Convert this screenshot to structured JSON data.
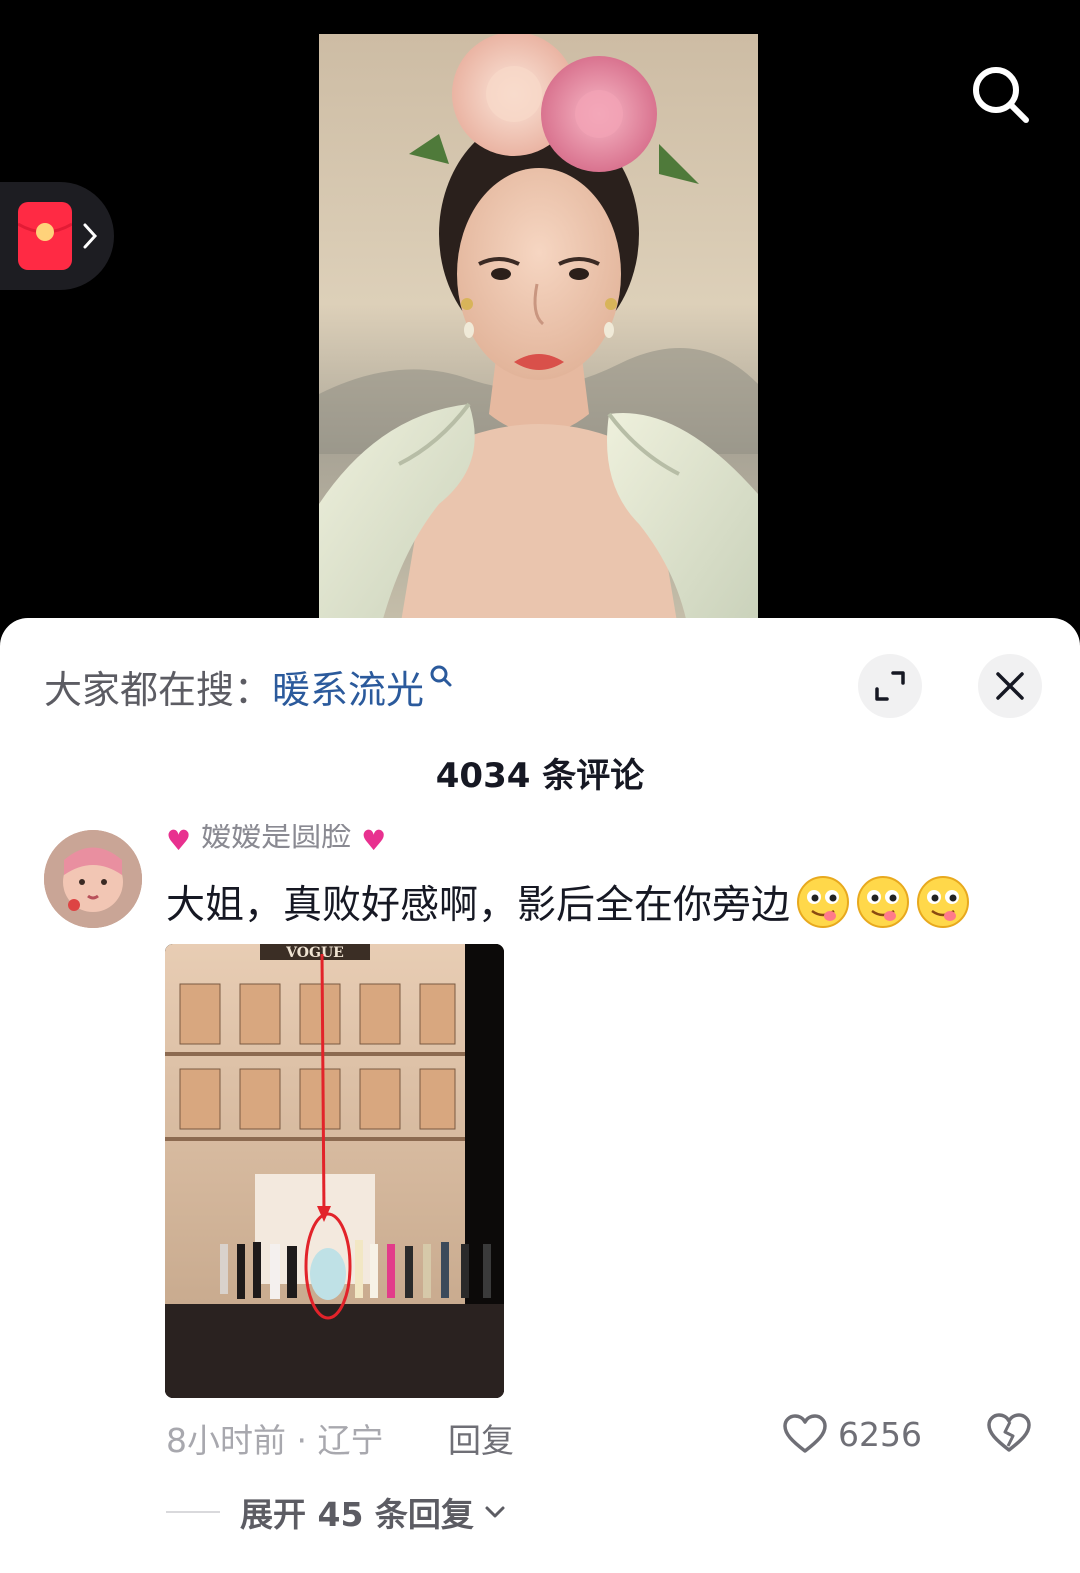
{
  "top": {
    "search_icon": "search-icon",
    "red_packet_icon": "red-packet-icon"
  },
  "sheet": {
    "hot_search_prefix": "大家都在搜：",
    "hot_search_keyword": "暖系流光",
    "comment_count_title": "4034 条评论"
  },
  "comment": {
    "username": "嫒嫒是圆脸",
    "text": "大姐，真败好感啊，影后全在你旁边",
    "image_sign_text": "VOGUE",
    "time_location": "8小时前 · 辽宁",
    "reply_label": "回复",
    "like_count": "6256",
    "expand_replies_label": "展开 45 条回复"
  },
  "colors": {
    "keyword_link": "#2b5a9c",
    "heart_accent": "#e8318f",
    "red_packet": "#ff2a44",
    "sheet_bg": "#ffffff",
    "video_bg": "#000000"
  }
}
